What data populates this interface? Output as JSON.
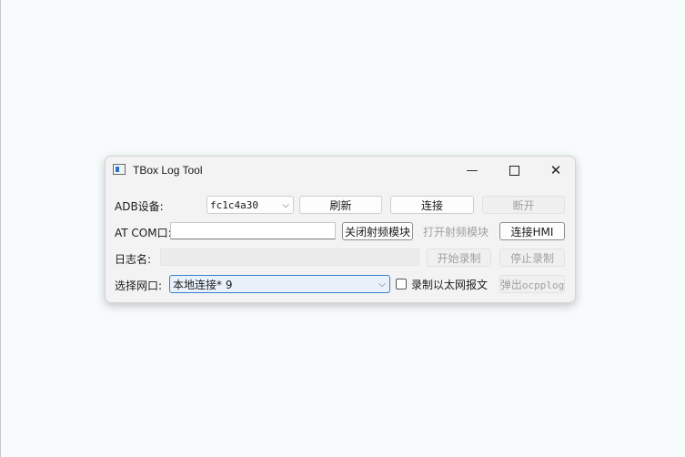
{
  "window": {
    "title": "TBox Log Tool",
    "icons": {
      "app": "app-window-icon",
      "minimize": "minimize-icon",
      "maximize": "maximize-icon",
      "close": "close-icon"
    },
    "glyphs": {
      "minimize": "—",
      "close": "✕",
      "chevron": "⌵"
    }
  },
  "adb": {
    "label": "ADB设备:",
    "device_value": "fc1c4a30",
    "refresh_label": "刷新",
    "connect_label": "连接",
    "disconnect_label": "断开"
  },
  "at": {
    "label": "AT COM口:",
    "value": "",
    "close_rf_label": "关闭射频模块",
    "open_rf_label": "打开射频模块",
    "connect_hmi_label": "连接HMI"
  },
  "log": {
    "label": "日志名:",
    "value": "",
    "start_label": "开始录制",
    "stop_label": "停止录制"
  },
  "net": {
    "label": "选择网口:",
    "selected": "本地连接* 9",
    "record_ethernet_label": "录制以太网报文",
    "record_ethernet_checked": false,
    "popup_prefix": "弹出",
    "popup_suffix": "ocpplog"
  }
}
